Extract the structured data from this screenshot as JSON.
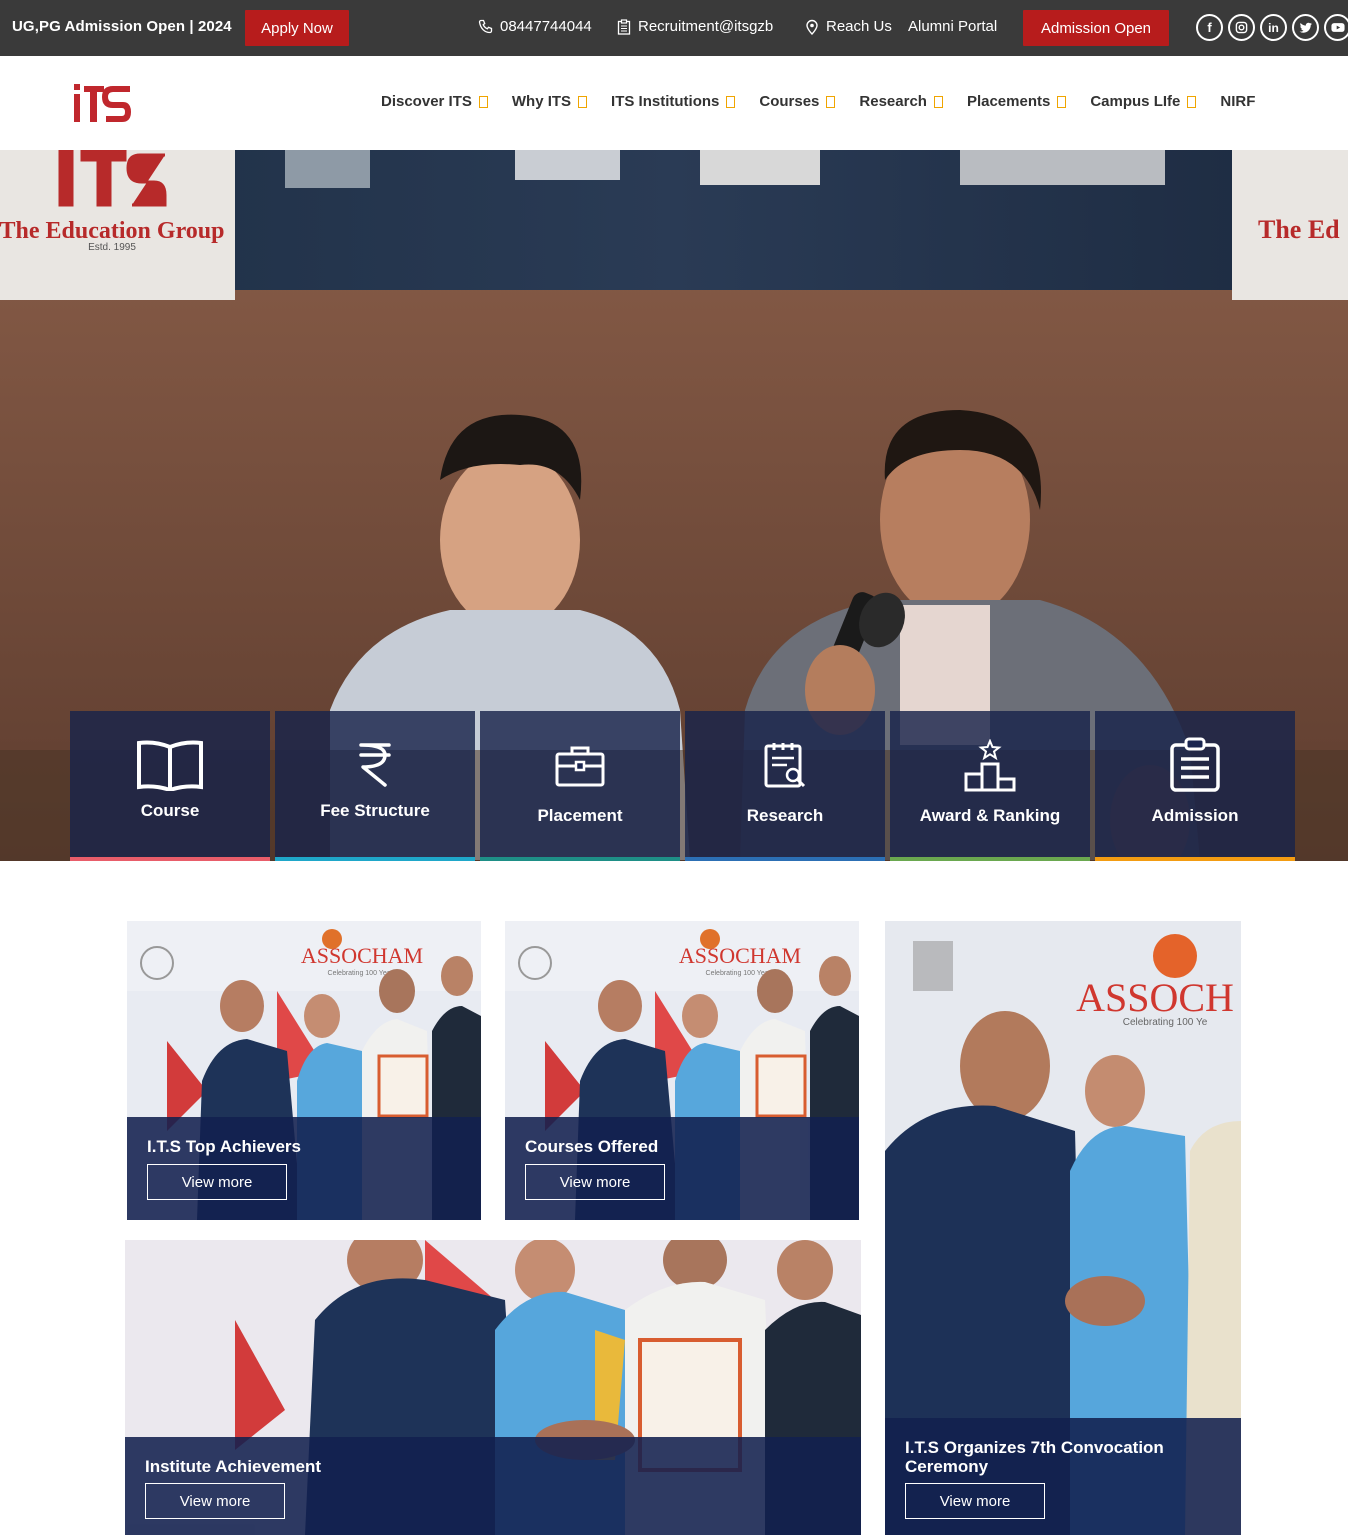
{
  "topbar": {
    "tagline": "UG,PG Admission Open | 2024",
    "apply_label": "Apply Now",
    "phone": "08447744044",
    "email": "Recruitment@itsgzb",
    "reach": "Reach Us",
    "alumni": "Alumni Portal",
    "admission_label": "Admission Open",
    "socials": [
      "facebook-icon",
      "instagram-icon",
      "linkedin-icon",
      "twitter-icon",
      "youtube-icon"
    ]
  },
  "header": {
    "logo_text": "iTS",
    "nav": [
      "Discover ITS",
      "Why ITS",
      "ITS Institutions",
      "Courses",
      "Research",
      "Placements",
      "Campus LIfe",
      "NIRF"
    ]
  },
  "hero": {
    "banner_line1": "The Education Group",
    "banner_line2": "Estd. 1995",
    "banner_right": "The Ed",
    "tiles": [
      {
        "label": "Course",
        "icon": "book-icon",
        "color": "#e85d6a"
      },
      {
        "label": "Fee Structure",
        "icon": "rupee-icon",
        "color": "#1fa7c9"
      },
      {
        "label": "Placement",
        "icon": "briefcase-icon",
        "color": "#1e8f86"
      },
      {
        "label": "Research",
        "icon": "research-icon",
        "color": "#2c6fb4"
      },
      {
        "label": "Award & Ranking",
        "icon": "award-icon",
        "color": "#6aa84f"
      },
      {
        "label": "Admission",
        "icon": "clipboard-icon",
        "color": "#f39c12"
      }
    ]
  },
  "cards": [
    {
      "title": "I.T.S Top Achievers",
      "button": "View more",
      "banner": "ASSOCHAM",
      "sub": "Celebrating 100 Years"
    },
    {
      "title": "Courses Offered",
      "button": "View more",
      "banner": "ASSOCHAM",
      "sub": "Celebrating 100 Years"
    },
    {
      "title": "I.T.S Organizes 7th Convocation Ceremony",
      "button": "View more",
      "banner": "ASSOCH",
      "sub": "Celebrating 100 Ye"
    },
    {
      "title": "Institute Achievement",
      "button": "View more"
    }
  ]
}
